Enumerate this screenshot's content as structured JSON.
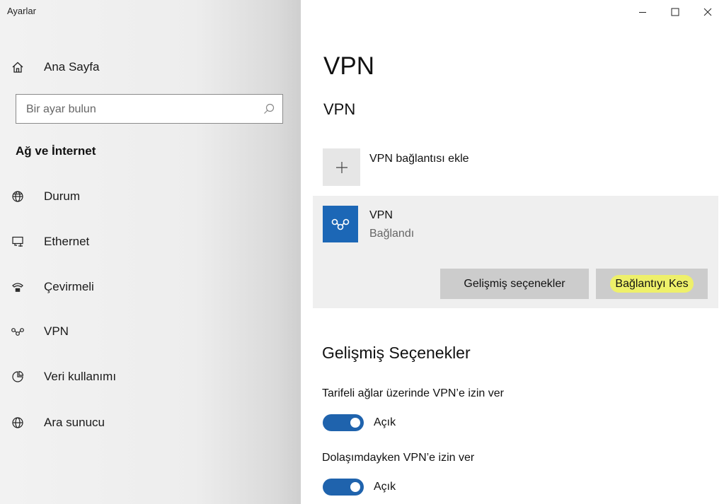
{
  "window": {
    "title": "Ayarlar"
  },
  "sidebar": {
    "home_label": "Ana Sayfa",
    "search": {
      "placeholder": "Bir ayar bulun",
      "value": ""
    },
    "section_title": "Ağ ve İnternet",
    "items": [
      {
        "label": "Durum",
        "icon": "status-globe-icon"
      },
      {
        "label": "Ethernet",
        "icon": "ethernet-icon"
      },
      {
        "label": "Çevirmeli",
        "icon": "dialup-phone-icon"
      },
      {
        "label": "VPN",
        "icon": "vpn-icon"
      },
      {
        "label": "Veri kullanımı",
        "icon": "data-usage-icon"
      },
      {
        "label": "Ara sunucu",
        "icon": "proxy-globe-icon"
      }
    ]
  },
  "main": {
    "title": "VPN",
    "subtitle": "VPN",
    "add_connection_label": "VPN bağlantısı ekle",
    "connection": {
      "name": "VPN",
      "status": "Bağlandı",
      "advanced_button": "Gelişmiş seçenekler",
      "disconnect_button": "Bağlantıyı Kes"
    },
    "advanced": {
      "title": "Gelişmiş Seçenekler",
      "options": [
        {
          "label": "Tarifeli ağlar üzerinde VPN’e izin ver",
          "state": "Açık",
          "on": true
        },
        {
          "label": "Dolaşımdayken VPN’e izin ver",
          "state": "Açık",
          "on": true
        }
      ]
    }
  },
  "colors": {
    "accent": "#1f63ad",
    "vpn_tile": "#1c67b6",
    "highlight": "#eef06a"
  }
}
